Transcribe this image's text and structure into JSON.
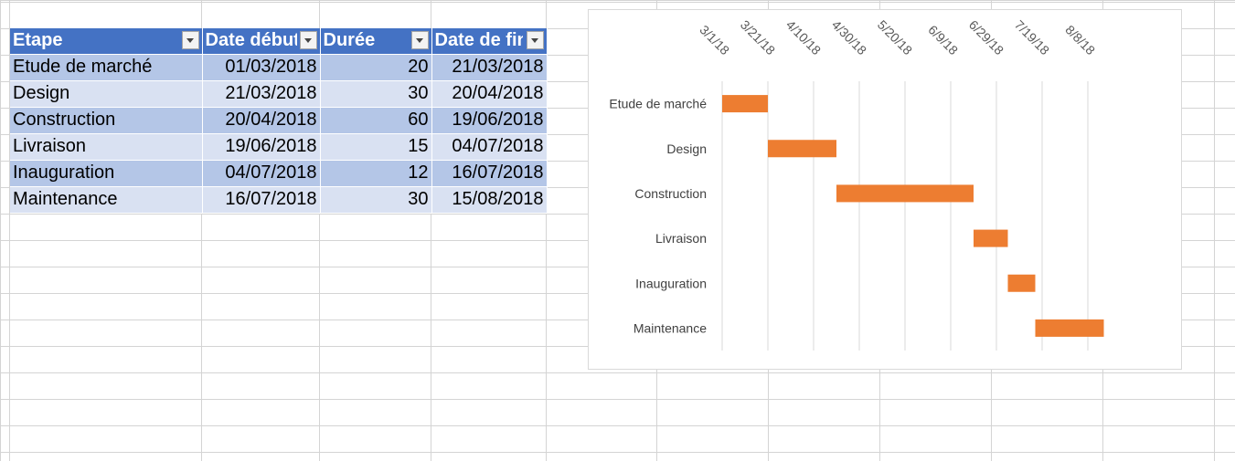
{
  "table": {
    "headers": [
      "Etape",
      "Date début",
      "Durée",
      "Date de fin"
    ],
    "rows": [
      {
        "etape": "Etude de marché",
        "debut": "01/03/2018",
        "duree": "20",
        "fin": "21/03/2018"
      },
      {
        "etape": "Design",
        "debut": "21/03/2018",
        "duree": "30",
        "fin": "20/04/2018"
      },
      {
        "etape": "Construction",
        "debut": "20/04/2018",
        "duree": "60",
        "fin": "19/06/2018"
      },
      {
        "etape": "Livraison",
        "debut": "19/06/2018",
        "duree": "15",
        "fin": "04/07/2018"
      },
      {
        "etape": "Inauguration",
        "debut": "04/07/2018",
        "duree": "12",
        "fin": "16/07/2018"
      },
      {
        "etape": "Maintenance",
        "debut": "16/07/2018",
        "duree": "30",
        "fin": "15/08/2018"
      }
    ],
    "header_color": "#4472c4",
    "band_colors": [
      "#b4c6e7",
      "#d9e1f2"
    ]
  },
  "chart_data": {
    "type": "bar",
    "orientation": "horizontal-stacked-gantt",
    "title": "",
    "categories": [
      "Etude de marché",
      "Design",
      "Construction",
      "Livraison",
      "Inauguration",
      "Maintenance"
    ],
    "series": [
      {
        "start": [
          "2018-03-01",
          "2018-03-21",
          "2018-04-20",
          "2018-06-19",
          "2018-07-04",
          "2018-07-16"
        ],
        "visible": false
      },
      {
        "values": [
          20,
          30,
          60,
          15,
          12,
          30
        ],
        "color": "#ed7d31"
      }
    ],
    "x_tick_labels": [
      "3/1/18",
      "3/21/18",
      "4/10/18",
      "4/30/18",
      "5/20/18",
      "6/9/18",
      "6/29/18",
      "7/19/18",
      "8/8/18"
    ],
    "xlim": [
      "2018-03-01",
      "2018-08-28"
    ],
    "x_major_unit_days": 20,
    "grid": true,
    "legend": "none"
  }
}
